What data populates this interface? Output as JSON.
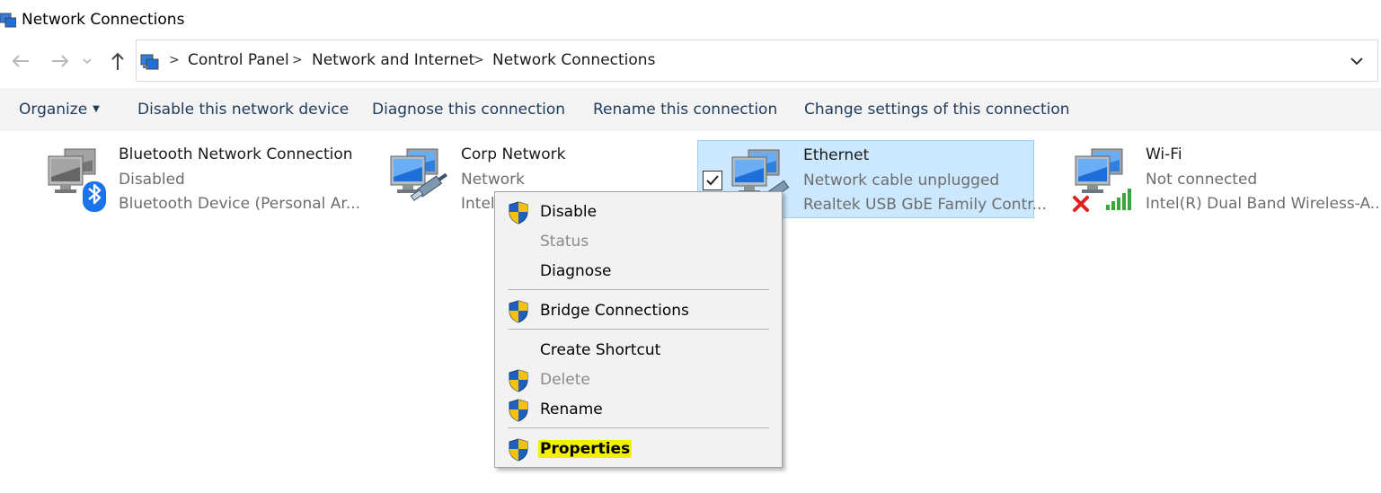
{
  "window": {
    "title": "Network Connections"
  },
  "address_bar": {
    "crumbs": [
      "Control Panel",
      "Network and Internet",
      "Network Connections"
    ]
  },
  "command_bar": {
    "organize": "Organize",
    "disable_device": "Disable this network device",
    "diagnose": "Diagnose this connection",
    "rename": "Rename this connection",
    "change_settings": "Change settings of this connection"
  },
  "connections": [
    {
      "name": "Bluetooth Network Connection",
      "status": "Disabled",
      "device": "Bluetooth Device (Personal Ar...",
      "icon": "bluetooth-network-icon"
    },
    {
      "name": "Corp Network",
      "status": "Network",
      "device": "Intel(",
      "icon": "wired-network-icon"
    },
    {
      "name": "Ethernet",
      "status": "Network cable unplugged",
      "device": "Realtek USB GbE Family Contr...",
      "icon": "ethernet-network-icon",
      "selected": true
    },
    {
      "name": "Wi-Fi",
      "status": "Not connected",
      "device": "Intel(R) Dual Band Wireless-A...",
      "icon": "wifi-network-icon"
    }
  ],
  "context_menu": {
    "items": [
      {
        "label": "Disable",
        "shield": true,
        "enabled": true
      },
      {
        "label": "Status",
        "shield": false,
        "enabled": false
      },
      {
        "label": "Diagnose",
        "shield": false,
        "enabled": true
      },
      {
        "label": "Bridge Connections",
        "shield": true,
        "enabled": true
      },
      {
        "label": "Create Shortcut",
        "shield": false,
        "enabled": true
      },
      {
        "label": "Delete",
        "shield": true,
        "enabled": false
      },
      {
        "label": "Rename",
        "shield": true,
        "enabled": true
      },
      {
        "label": "Properties",
        "shield": true,
        "enabled": true,
        "highlighted": true
      }
    ]
  },
  "colors": {
    "selection_bg": "#cce8ff",
    "highlight": "#f0f000",
    "shield_blue": "#1f5fbf",
    "shield_yellow": "#f4c20d"
  }
}
